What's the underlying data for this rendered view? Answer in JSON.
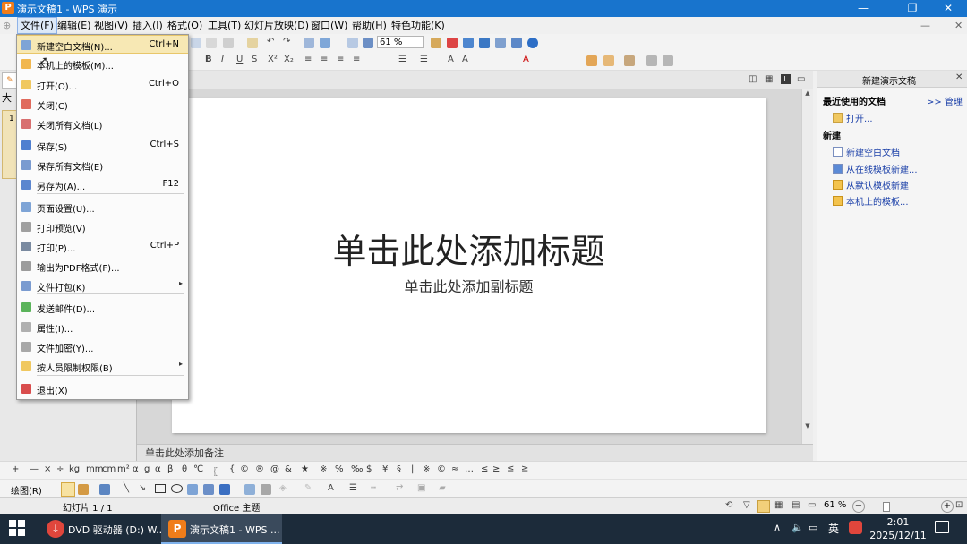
{
  "window": {
    "title": "演示文稿1 - WPS 演示",
    "app_icon": "P"
  },
  "menubar": {
    "items": [
      "文件(F)",
      "编辑(E)",
      "视图(V)",
      "插入(I)",
      "格式(O)",
      "工具(T)",
      "幻灯片放映(D)",
      "窗口(W)",
      "帮助(H)",
      "特色功能(K)"
    ]
  },
  "toolbar": {
    "zoom": "61 %"
  },
  "left_tab": "大",
  "slide_number": "1",
  "file_menu": {
    "items": [
      {
        "label": "新建空白文档(N)...",
        "shortcut": "Ctrl+N",
        "icon": "new-doc-icon"
      },
      {
        "label": "本机上的模板(M)...",
        "shortcut": "",
        "icon": "template-icon"
      },
      {
        "label": "打开(O)...",
        "shortcut": "Ctrl+O",
        "icon": "open-folder-icon"
      },
      {
        "label": "关闭(C)",
        "shortcut": "",
        "icon": "close-doc-icon"
      },
      {
        "label": "关闭所有文档(L)",
        "shortcut": "",
        "icon": "close-all-icon"
      },
      {
        "label": "保存(S)",
        "shortcut": "Ctrl+S",
        "icon": "save-icon"
      },
      {
        "label": "保存所有文档(E)",
        "shortcut": "",
        "icon": "save-all-icon"
      },
      {
        "label": "另存为(A)...",
        "shortcut": "F12",
        "icon": "save-as-icon"
      },
      {
        "label": "页面设置(U)...",
        "shortcut": "",
        "icon": "page-setup-icon"
      },
      {
        "label": "打印预览(V)",
        "shortcut": "",
        "icon": "print-preview-icon"
      },
      {
        "label": "打印(P)...",
        "shortcut": "Ctrl+P",
        "icon": "print-icon"
      },
      {
        "label": "输出为PDF格式(F)...",
        "shortcut": "",
        "icon": "pdf-icon"
      },
      {
        "label": "文件打包(K)",
        "shortcut": "",
        "icon": "package-icon"
      },
      {
        "label": "发送邮件(D)...",
        "shortcut": "",
        "icon": "mail-icon"
      },
      {
        "label": "属性(I)...",
        "shortcut": "",
        "icon": "properties-icon"
      },
      {
        "label": "文件加密(Y)...",
        "shortcut": "",
        "icon": "encrypt-icon"
      },
      {
        "label": "按人员限制权限(B)",
        "shortcut": "",
        "icon": "permission-icon"
      },
      {
        "label": "退出(X)",
        "shortcut": "",
        "icon": "exit-icon"
      }
    ]
  },
  "slide": {
    "title": "单击此处添加标题",
    "subtitle": "单击此处添加副标题"
  },
  "notes": {
    "placeholder": "单击此处添加备注"
  },
  "task_pane": {
    "title": "新建演示文稿",
    "recent_heading": "最近使用的文档",
    "manage_link": ">> 管理",
    "open_link": "打开...",
    "new_heading": "新建",
    "new_items": [
      "新建空白文档",
      "从在线模板新建...",
      "从默认模板新建",
      "本机上的模板..."
    ]
  },
  "draw_toolbar": {
    "label": "绘图(R)"
  },
  "symbols": [
    "+",
    "—",
    "×",
    "÷",
    "kg",
    "mm",
    "cm",
    "m²",
    "α",
    "g",
    "α",
    "β",
    "θ",
    "℃",
    "〖",
    "{",
    "©",
    "®",
    "@",
    "&",
    "★",
    "※",
    "%",
    "‰",
    "$",
    "¥",
    "§",
    "|",
    "※",
    "©",
    "≈",
    "…",
    "≤",
    "≥",
    "≦",
    "≧"
  ],
  "statusbar": {
    "slide_info": "幻灯片 1 / 1",
    "theme": "Office 主题",
    "zoom": "61 %"
  },
  "taskbar": {
    "apps": [
      {
        "label": "DVD 驱动器 (D:) W...",
        "active": false
      },
      {
        "label": "演示文稿1 - WPS ...",
        "active": true
      }
    ],
    "ime": "英",
    "time": "2:01",
    "date": "2025/12/11"
  },
  "colors": {
    "titlebar": "#1874cd",
    "menu_highlight": "#f7e8b4",
    "link": "#1a3fa8",
    "taskbar": "#1c2b3a",
    "wps_orange": "#f07d1a"
  }
}
